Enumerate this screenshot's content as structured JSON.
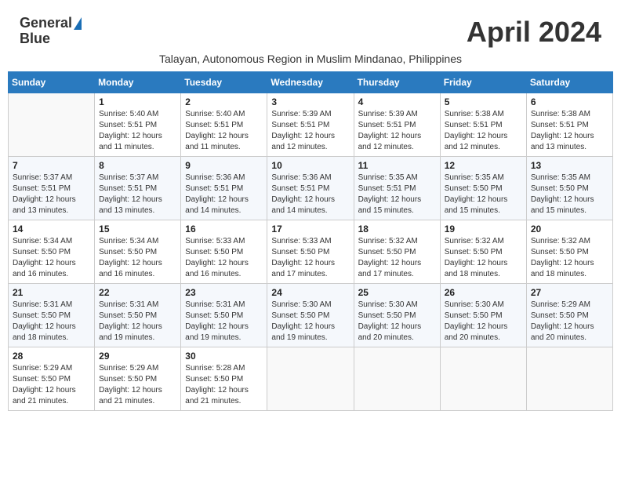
{
  "header": {
    "logo_general": "General",
    "logo_blue": "Blue",
    "month_title": "April 2024",
    "subtitle": "Talayan, Autonomous Region in Muslim Mindanao, Philippines"
  },
  "calendar": {
    "weekdays": [
      "Sunday",
      "Monday",
      "Tuesday",
      "Wednesday",
      "Thursday",
      "Friday",
      "Saturday"
    ],
    "weeks": [
      [
        {
          "day": "",
          "sunrise": "",
          "sunset": "",
          "daylight": ""
        },
        {
          "day": "1",
          "sunrise": "Sunrise: 5:40 AM",
          "sunset": "Sunset: 5:51 PM",
          "daylight": "Daylight: 12 hours and 11 minutes."
        },
        {
          "day": "2",
          "sunrise": "Sunrise: 5:40 AM",
          "sunset": "Sunset: 5:51 PM",
          "daylight": "Daylight: 12 hours and 11 minutes."
        },
        {
          "day": "3",
          "sunrise": "Sunrise: 5:39 AM",
          "sunset": "Sunset: 5:51 PM",
          "daylight": "Daylight: 12 hours and 12 minutes."
        },
        {
          "day": "4",
          "sunrise": "Sunrise: 5:39 AM",
          "sunset": "Sunset: 5:51 PM",
          "daylight": "Daylight: 12 hours and 12 minutes."
        },
        {
          "day": "5",
          "sunrise": "Sunrise: 5:38 AM",
          "sunset": "Sunset: 5:51 PM",
          "daylight": "Daylight: 12 hours and 12 minutes."
        },
        {
          "day": "6",
          "sunrise": "Sunrise: 5:38 AM",
          "sunset": "Sunset: 5:51 PM",
          "daylight": "Daylight: 12 hours and 13 minutes."
        }
      ],
      [
        {
          "day": "7",
          "sunrise": "Sunrise: 5:37 AM",
          "sunset": "Sunset: 5:51 PM",
          "daylight": "Daylight: 12 hours and 13 minutes."
        },
        {
          "day": "8",
          "sunrise": "Sunrise: 5:37 AM",
          "sunset": "Sunset: 5:51 PM",
          "daylight": "Daylight: 12 hours and 13 minutes."
        },
        {
          "day": "9",
          "sunrise": "Sunrise: 5:36 AM",
          "sunset": "Sunset: 5:51 PM",
          "daylight": "Daylight: 12 hours and 14 minutes."
        },
        {
          "day": "10",
          "sunrise": "Sunrise: 5:36 AM",
          "sunset": "Sunset: 5:51 PM",
          "daylight": "Daylight: 12 hours and 14 minutes."
        },
        {
          "day": "11",
          "sunrise": "Sunrise: 5:35 AM",
          "sunset": "Sunset: 5:51 PM",
          "daylight": "Daylight: 12 hours and 15 minutes."
        },
        {
          "day": "12",
          "sunrise": "Sunrise: 5:35 AM",
          "sunset": "Sunset: 5:50 PM",
          "daylight": "Daylight: 12 hours and 15 minutes."
        },
        {
          "day": "13",
          "sunrise": "Sunrise: 5:35 AM",
          "sunset": "Sunset: 5:50 PM",
          "daylight": "Daylight: 12 hours and 15 minutes."
        }
      ],
      [
        {
          "day": "14",
          "sunrise": "Sunrise: 5:34 AM",
          "sunset": "Sunset: 5:50 PM",
          "daylight": "Daylight: 12 hours and 16 minutes."
        },
        {
          "day": "15",
          "sunrise": "Sunrise: 5:34 AM",
          "sunset": "Sunset: 5:50 PM",
          "daylight": "Daylight: 12 hours and 16 minutes."
        },
        {
          "day": "16",
          "sunrise": "Sunrise: 5:33 AM",
          "sunset": "Sunset: 5:50 PM",
          "daylight": "Daylight: 12 hours and 16 minutes."
        },
        {
          "day": "17",
          "sunrise": "Sunrise: 5:33 AM",
          "sunset": "Sunset: 5:50 PM",
          "daylight": "Daylight: 12 hours and 17 minutes."
        },
        {
          "day": "18",
          "sunrise": "Sunrise: 5:32 AM",
          "sunset": "Sunset: 5:50 PM",
          "daylight": "Daylight: 12 hours and 17 minutes."
        },
        {
          "day": "19",
          "sunrise": "Sunrise: 5:32 AM",
          "sunset": "Sunset: 5:50 PM",
          "daylight": "Daylight: 12 hours and 18 minutes."
        },
        {
          "day": "20",
          "sunrise": "Sunrise: 5:32 AM",
          "sunset": "Sunset: 5:50 PM",
          "daylight": "Daylight: 12 hours and 18 minutes."
        }
      ],
      [
        {
          "day": "21",
          "sunrise": "Sunrise: 5:31 AM",
          "sunset": "Sunset: 5:50 PM",
          "daylight": "Daylight: 12 hours and 18 minutes."
        },
        {
          "day": "22",
          "sunrise": "Sunrise: 5:31 AM",
          "sunset": "Sunset: 5:50 PM",
          "daylight": "Daylight: 12 hours and 19 minutes."
        },
        {
          "day": "23",
          "sunrise": "Sunrise: 5:31 AM",
          "sunset": "Sunset: 5:50 PM",
          "daylight": "Daylight: 12 hours and 19 minutes."
        },
        {
          "day": "24",
          "sunrise": "Sunrise: 5:30 AM",
          "sunset": "Sunset: 5:50 PM",
          "daylight": "Daylight: 12 hours and 19 minutes."
        },
        {
          "day": "25",
          "sunrise": "Sunrise: 5:30 AM",
          "sunset": "Sunset: 5:50 PM",
          "daylight": "Daylight: 12 hours and 20 minutes."
        },
        {
          "day": "26",
          "sunrise": "Sunrise: 5:30 AM",
          "sunset": "Sunset: 5:50 PM",
          "daylight": "Daylight: 12 hours and 20 minutes."
        },
        {
          "day": "27",
          "sunrise": "Sunrise: 5:29 AM",
          "sunset": "Sunset: 5:50 PM",
          "daylight": "Daylight: 12 hours and 20 minutes."
        }
      ],
      [
        {
          "day": "28",
          "sunrise": "Sunrise: 5:29 AM",
          "sunset": "Sunset: 5:50 PM",
          "daylight": "Daylight: 12 hours and 21 minutes."
        },
        {
          "day": "29",
          "sunrise": "Sunrise: 5:29 AM",
          "sunset": "Sunset: 5:50 PM",
          "daylight": "Daylight: 12 hours and 21 minutes."
        },
        {
          "day": "30",
          "sunrise": "Sunrise: 5:28 AM",
          "sunset": "Sunset: 5:50 PM",
          "daylight": "Daylight: 12 hours and 21 minutes."
        },
        {
          "day": "",
          "sunrise": "",
          "sunset": "",
          "daylight": ""
        },
        {
          "day": "",
          "sunrise": "",
          "sunset": "",
          "daylight": ""
        },
        {
          "day": "",
          "sunrise": "",
          "sunset": "",
          "daylight": ""
        },
        {
          "day": "",
          "sunrise": "",
          "sunset": "",
          "daylight": ""
        }
      ]
    ]
  }
}
